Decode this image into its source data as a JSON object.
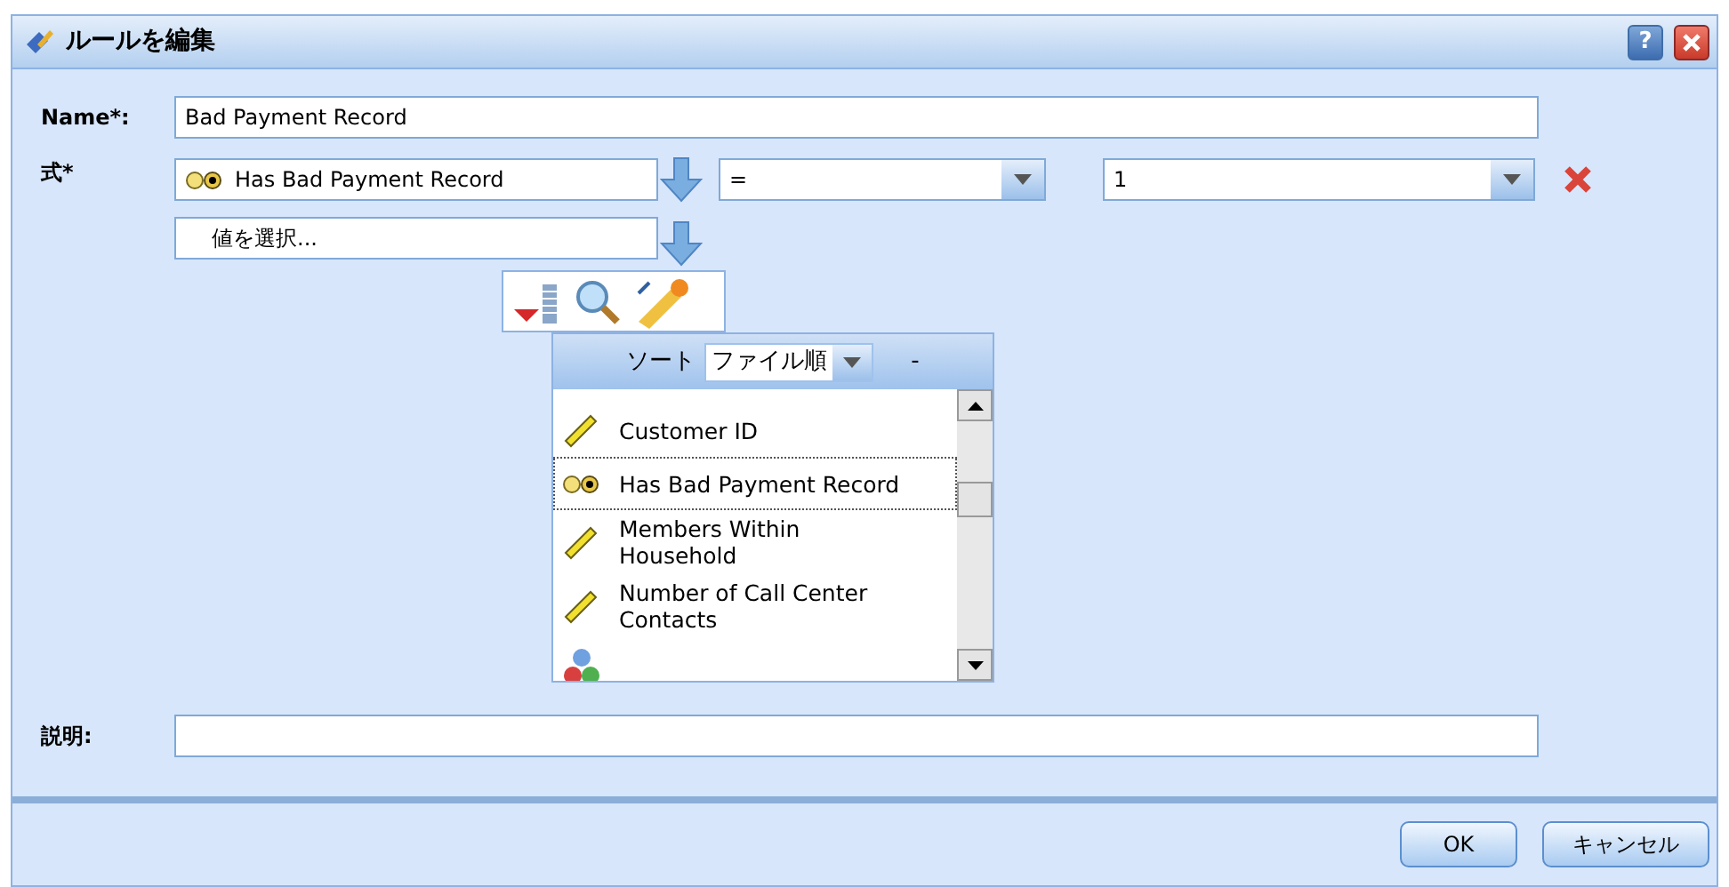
{
  "window": {
    "title": "ルールを編集",
    "help_label": "?"
  },
  "name_field": {
    "label": "Name*:",
    "value": "Bad Payment Record"
  },
  "expression": {
    "label": "式*",
    "field": {
      "value": "Has Bad Payment Record",
      "kind": "flag"
    },
    "operator": {
      "value": "="
    },
    "operand": {
      "value": "1"
    },
    "value_picker": {
      "value": "値を選択..."
    }
  },
  "field_popup": {
    "sort_label": "ソート",
    "sort_value": "ファイル順",
    "collapse_label": "-",
    "items": [
      {
        "label": "Customer ID",
        "kind": "range",
        "selected": false
      },
      {
        "label": "Has Bad Payment Record",
        "kind": "flag",
        "selected": true
      },
      {
        "label": "Members Within Household",
        "kind": "range",
        "selected": false
      },
      {
        "label": "Number of Call Center Contacts",
        "kind": "range",
        "selected": false
      },
      {
        "kind": "set",
        "selected": false
      }
    ]
  },
  "description": {
    "label": "説明:"
  },
  "buttons": [
    {
      "label": "OK"
    },
    {
      "label": "キャンセル"
    }
  ]
}
